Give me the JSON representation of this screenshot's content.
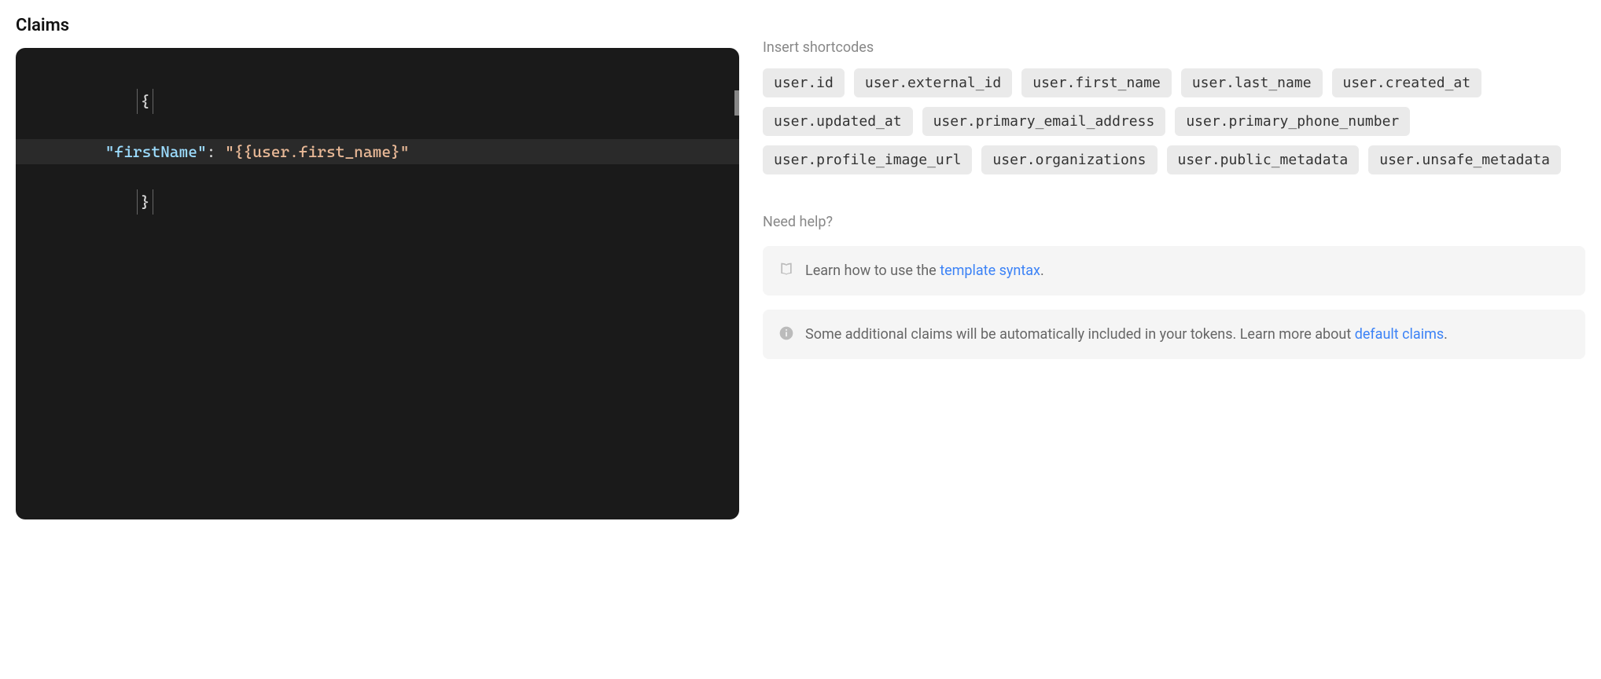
{
  "section": {
    "title": "Claims"
  },
  "editor": {
    "line1": "{",
    "line2_key": "\"firstName\"",
    "line2_colon": ": ",
    "line2_value": "\"{{user.first_name}\"",
    "line3": "}"
  },
  "shortcodes": {
    "label": "Insert shortcodes",
    "items": [
      "user.id",
      "user.external_id",
      "user.first_name",
      "user.last_name",
      "user.created_at",
      "user.updated_at",
      "user.primary_email_address",
      "user.primary_phone_number",
      "user.profile_image_url",
      "user.organizations",
      "user.public_metadata",
      "user.unsafe_metadata"
    ]
  },
  "help": {
    "label": "Need help?",
    "card1": {
      "text_before": "Learn how to use the ",
      "link_text": "template syntax",
      "text_after": "."
    },
    "card2": {
      "text_before": "Some additional claims will be automatically included in your tokens. Learn more about ",
      "link_text": "default claims",
      "text_after": "."
    }
  }
}
